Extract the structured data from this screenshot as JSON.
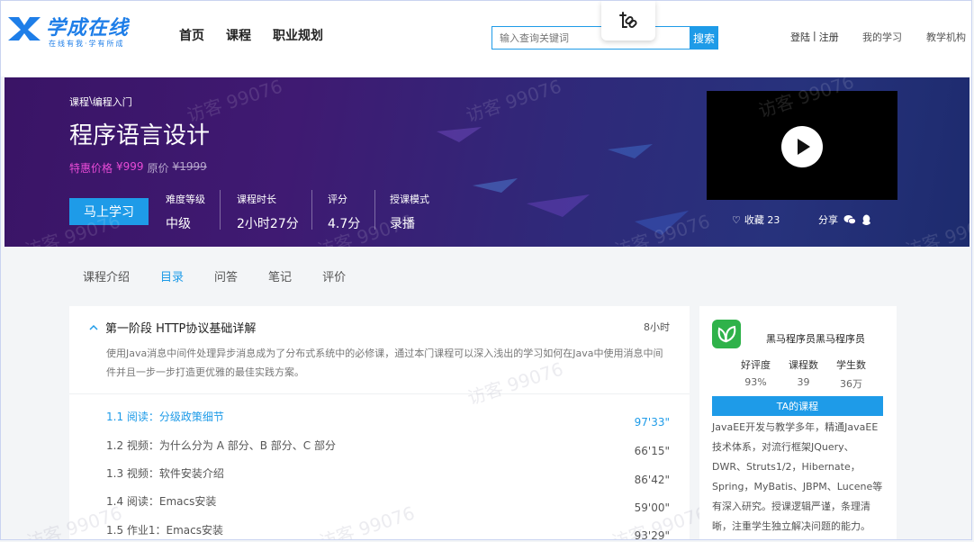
{
  "header": {
    "logo": {
      "name": "学成在线",
      "slogan": "在线有我·学有所成"
    },
    "nav": [
      "首页",
      "课程",
      "职业规划"
    ],
    "search": {
      "placeholder": "输入查询关键词",
      "button": "搜索"
    },
    "login": "登陆",
    "separator": "|",
    "register": "注册",
    "my_study": "我的学习",
    "teaching": "教学机构",
    "popup_icon": "link-icon"
  },
  "banner": {
    "breadcrumb": [
      "课程",
      "\\",
      "编程入门"
    ],
    "title": "程序语言设计",
    "price_label": "特惠价格",
    "price_now": "¥999",
    "price_old_prefix": "原价",
    "price_old": "¥1999",
    "study_button": "马上学习",
    "stats": [
      {
        "key": "难度等级",
        "value": "中级"
      },
      {
        "key": "课程时长",
        "value": "2小时27分"
      },
      {
        "key": "评分",
        "value": "4.7分"
      },
      {
        "key": "授课模式",
        "value": "录播"
      }
    ],
    "favorite": "收藏 23",
    "share": "分享"
  },
  "tabs": [
    {
      "label": "课程介绍",
      "active": false
    },
    {
      "label": "目录",
      "active": true
    },
    {
      "label": "问答",
      "active": false
    },
    {
      "label": "笔记",
      "active": false
    },
    {
      "label": "评价",
      "active": false
    }
  ],
  "chapter": {
    "title": "第一阶段 HTTP协议基础详解",
    "duration": "8小时",
    "description": "使用Java消息中间件处理异步消息成为了分布式系统中的必修课，通过本门课程可以深入浅出的学习如何在Java中使用消息中间件并且一步一步打造更优雅的最佳实践方案。",
    "lessons": [
      {
        "title": "1.1 阅读：分级政策细节",
        "time": "97'33\"",
        "active": true
      },
      {
        "title": "1.2 视频：为什么分为 A 部分、B 部分、C 部分",
        "time": "66'15\"",
        "active": false
      },
      {
        "title": "1.3 视频：软件安装介绍",
        "time": "86'42\"",
        "active": false
      },
      {
        "title": "1.4 阅读：Emacs安装",
        "time": "59'00\"",
        "active": false
      },
      {
        "title": "1.5 作业1：Emacs安装",
        "time": "93'29\"",
        "active": false
      }
    ]
  },
  "teacher": {
    "name": "黑马程序员黑马程序员",
    "stats": [
      {
        "key": "好评度",
        "value": "93%"
      },
      {
        "key": "课程数",
        "value": "39"
      },
      {
        "key": "学生数",
        "value": "36万"
      }
    ],
    "courses_button": "TA的课程",
    "bio": "JavaEE开发与教学多年，精通JavaEE技术体系，对流行框架JQuery、DWR、Struts1/2，Hibernate，Spring，MyBatis、JBPM、Lucene等有深入研究。授课逻辑严谨，条理清晰，注重学生独立解决问题的能力。"
  },
  "watermark": "访客 99076",
  "colors": {
    "accent": "#1e9be8",
    "price": "#e74bd6",
    "banner_start": "#3a1466",
    "banner_end": "#1d2b6e"
  }
}
